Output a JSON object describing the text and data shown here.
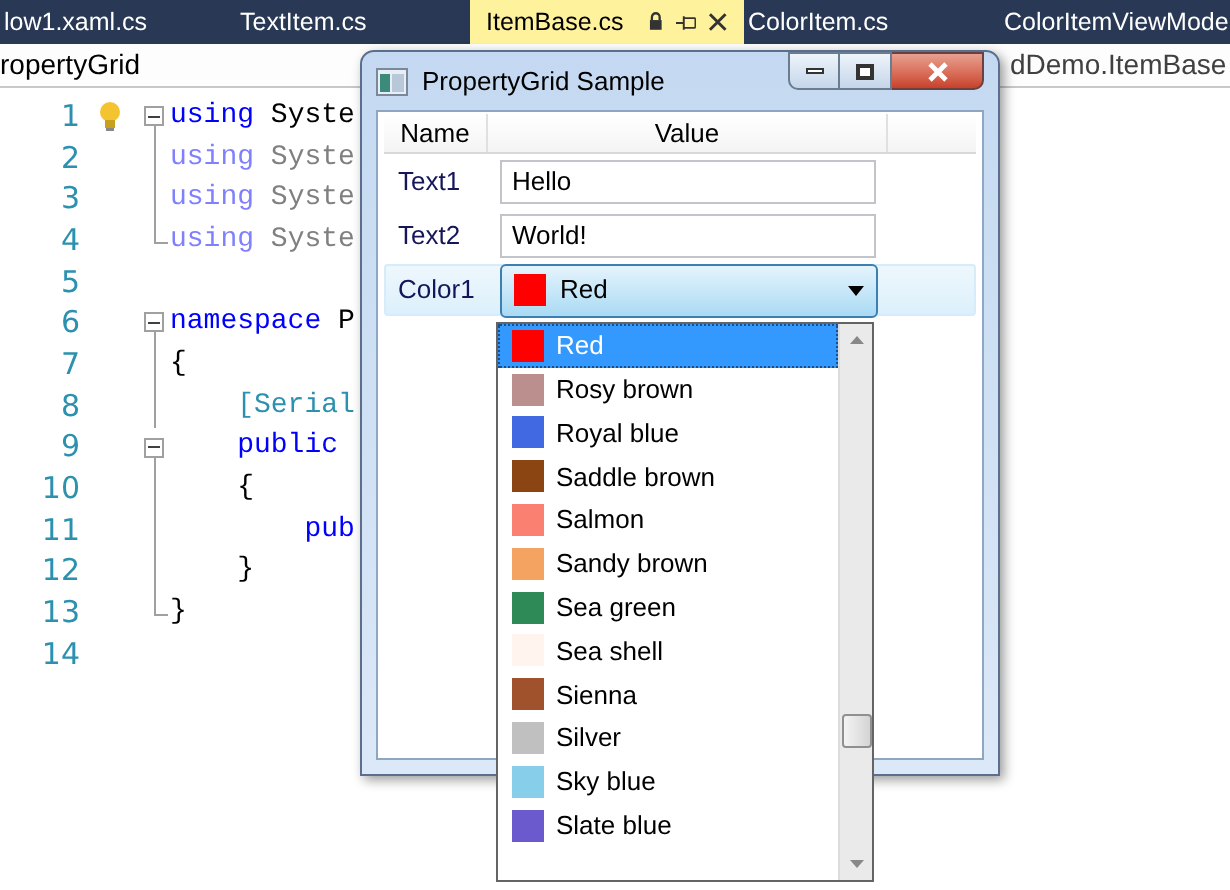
{
  "tabs": [
    {
      "label": "low1.xaml.cs",
      "selected": false
    },
    {
      "label": "TextItem.cs",
      "selected": false
    },
    {
      "label": "ItemBase.cs",
      "selected": true
    },
    {
      "label": "ColorItem.cs",
      "selected": false
    },
    {
      "label": "ColorItemViewMode",
      "selected": false
    }
  ],
  "breadcrumb": {
    "left": "ropertyGrid",
    "right": "dDemo.ItemBase"
  },
  "editor": {
    "lines": [
      {
        "number": "1",
        "hint": true,
        "kind": "fold-start",
        "tokens": [
          {
            "text": "using",
            "kind": "keyword"
          },
          {
            "text": " Syste",
            "kind": "plain"
          }
        ]
      },
      {
        "number": "2",
        "hint": false,
        "kind": "fold-line",
        "tokens": [
          {
            "text": "using",
            "kind": "faded-keyword"
          },
          {
            "text": " Syste",
            "kind": "faded"
          }
        ]
      },
      {
        "number": "3",
        "hint": false,
        "kind": "fold-line",
        "tokens": [
          {
            "text": "using",
            "kind": "faded-keyword"
          },
          {
            "text": " Syste",
            "kind": "faded"
          }
        ]
      },
      {
        "number": "4",
        "hint": false,
        "kind": "fold-end",
        "tokens": [
          {
            "text": "using",
            "kind": "faded-keyword"
          },
          {
            "text": " Syste",
            "kind": "faded"
          }
        ]
      },
      {
        "number": "5",
        "hint": false,
        "kind": "plain"
      },
      {
        "number": "6",
        "hint": false,
        "kind": "fold-start",
        "tokens": [
          {
            "text": "namespace",
            "kind": "keyword"
          },
          {
            "text": " P",
            "kind": "plain"
          }
        ]
      },
      {
        "number": "7",
        "hint": false,
        "kind": "fold-line",
        "tokens": [
          {
            "text": "{",
            "kind": "plain"
          }
        ]
      },
      {
        "number": "8",
        "hint": false,
        "kind": "fold-line",
        "tokens": [
          {
            "text": "    [Serial",
            "kind": "attribute"
          }
        ]
      },
      {
        "number": "9",
        "hint": false,
        "kind": "fold-start",
        "tokens": [
          {
            "text": "    public",
            "kind": "keyword"
          }
        ]
      },
      {
        "number": "10",
        "hint": false,
        "kind": "fold-line",
        "tokens": [
          {
            "text": "    {",
            "kind": "plain"
          }
        ]
      },
      {
        "number": "11",
        "hint": false,
        "kind": "fold-line",
        "tokens": [
          {
            "text": "        pub",
            "kind": "keyword"
          }
        ]
      },
      {
        "number": "12",
        "hint": false,
        "kind": "fold-line",
        "tokens": [
          {
            "text": "    }",
            "kind": "plain"
          }
        ]
      },
      {
        "number": "13",
        "hint": false,
        "kind": "fold-end",
        "tokens": [
          {
            "text": "}",
            "kind": "plain"
          }
        ]
      },
      {
        "number": "14",
        "hint": false,
        "kind": "plain"
      }
    ]
  },
  "window": {
    "title": "PropertyGrid Sample",
    "columns": [
      "Name",
      "Value"
    ],
    "rows": [
      {
        "name": "Text1",
        "kind": "text",
        "value": "Hello",
        "selected": false
      },
      {
        "name": "Text2",
        "kind": "text",
        "value": "World!",
        "selected": false
      },
      {
        "name": "Color1",
        "kind": "color",
        "value": "Red",
        "color": "#ff0000",
        "selected": true
      }
    ],
    "dropdown": {
      "items": [
        {
          "label": "Red",
          "color": "#ff0000",
          "selected": true
        },
        {
          "label": "Rosy brown",
          "color": "#bc8f8f",
          "selected": false
        },
        {
          "label": "Royal blue",
          "color": "#4169e1",
          "selected": false
        },
        {
          "label": "Saddle brown",
          "color": "#8b4513",
          "selected": false
        },
        {
          "label": "Salmon",
          "color": "#fa8072",
          "selected": false
        },
        {
          "label": "Sandy brown",
          "color": "#f4a460",
          "selected": false
        },
        {
          "label": "Sea green",
          "color": "#2e8b57",
          "selected": false
        },
        {
          "label": "Sea shell",
          "color": "#fff5ee",
          "selected": false
        },
        {
          "label": "Sienna",
          "color": "#a0522d",
          "selected": false
        },
        {
          "label": "Silver",
          "color": "#c0c0c0",
          "selected": false
        },
        {
          "label": "Sky blue",
          "color": "#87ceeb",
          "selected": false
        },
        {
          "label": "Slate blue",
          "color": "#6a5acd",
          "selected": false
        }
      ]
    }
  }
}
